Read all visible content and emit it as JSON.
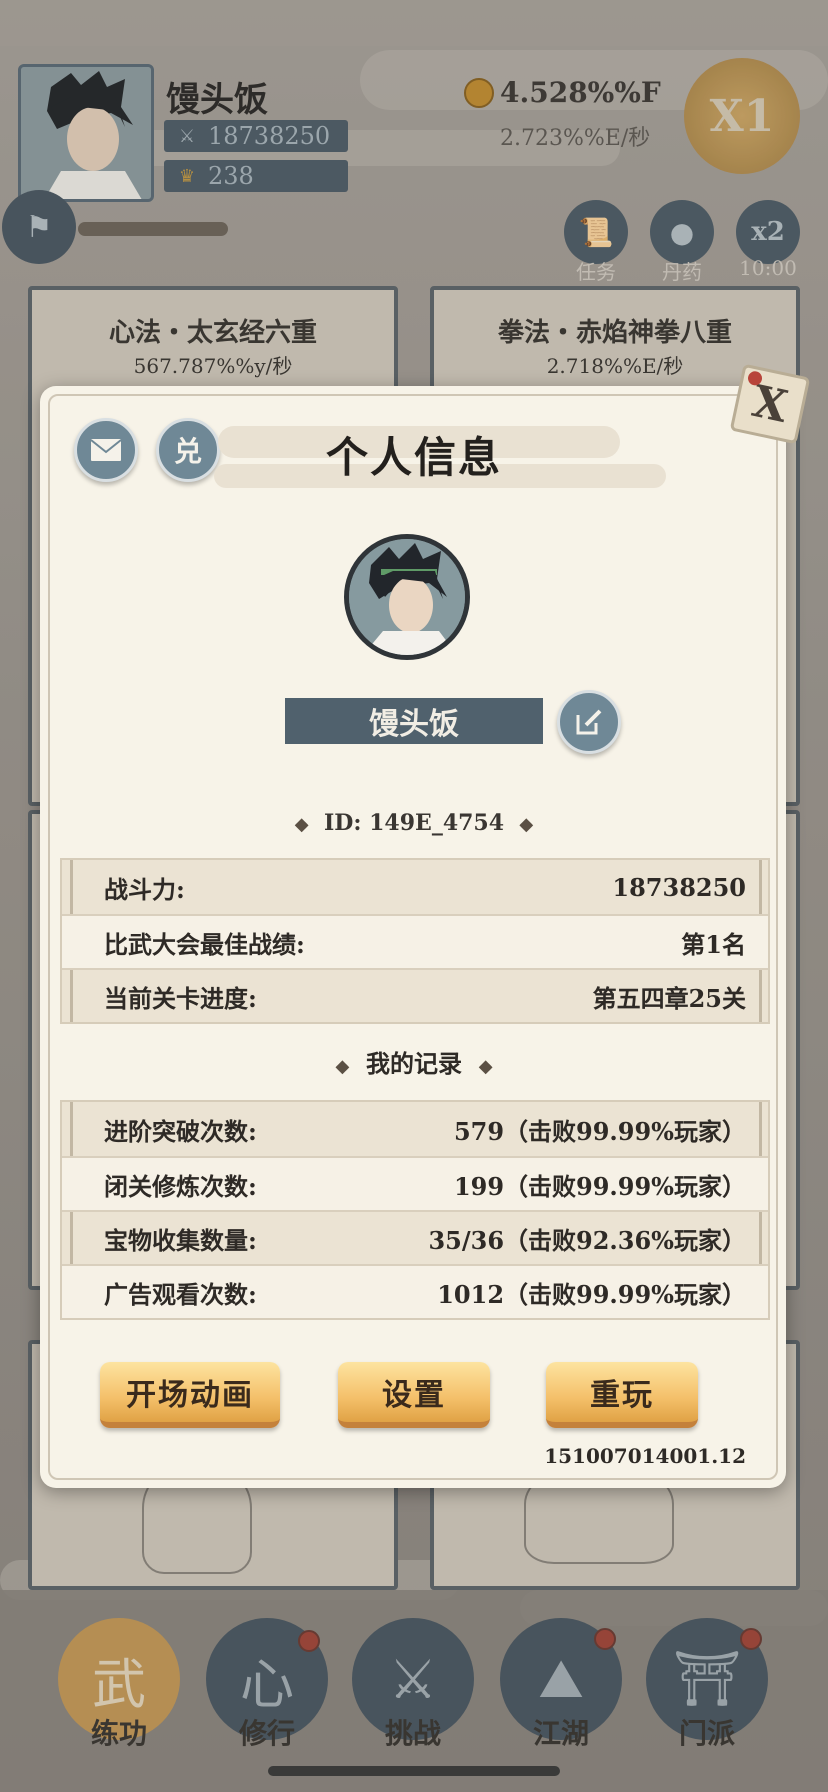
{
  "hud": {
    "player_name": "馒头饭",
    "power": "18738250",
    "gold_count": "238",
    "currency_amount": "4.528%%F",
    "currency_rate": "2.723%%E/秒",
    "speed_button": "X1",
    "task_label": "任务",
    "pill_label": "丹药",
    "x2_label": "x2",
    "x2_timer": "10:00"
  },
  "cards": [
    {
      "title": "心法・太玄经六重",
      "rate": "567.787%%y/秒"
    },
    {
      "title": "拳法・赤焰神拳八重",
      "rate": "2.718%%E/秒"
    }
  ],
  "modal": {
    "title": "个人信息",
    "mail_icon": "mail-icon",
    "redeem_label": "兑",
    "name": "馒头饭",
    "id_label": "ID:",
    "id_value": "149E_4754",
    "info_rows": [
      {
        "label": "战斗力:",
        "value": "18738250"
      },
      {
        "label": "比武大会最佳战绩:",
        "value": "第1名"
      },
      {
        "label": "当前关卡进度:",
        "value": "第五四章25关"
      }
    ],
    "records_title": "我的记录",
    "record_rows": [
      {
        "label": "进阶突破次数:",
        "value": "579（击败99.99%玩家）"
      },
      {
        "label": "闭关修炼次数:",
        "value": "199（击败99.99%玩家）"
      },
      {
        "label": "宝物收集数量:",
        "value": "35/36（击败92.36%玩家）"
      },
      {
        "label": "广告观看次数:",
        "value": "1012（击败99.99%玩家）"
      }
    ],
    "buttons": {
      "intro_animation": "开场动画",
      "settings": "设置",
      "replay": "重玩"
    },
    "version": "151007014001.12",
    "close_glyph": "X"
  },
  "nav": [
    {
      "label": "练功",
      "glyph": "武"
    },
    {
      "label": "修行",
      "glyph": "心"
    },
    {
      "label": "挑战",
      "glyph": "⚔"
    },
    {
      "label": "江湖",
      "glyph": "⛰"
    },
    {
      "label": "门派",
      "glyph": "⛩"
    }
  ]
}
